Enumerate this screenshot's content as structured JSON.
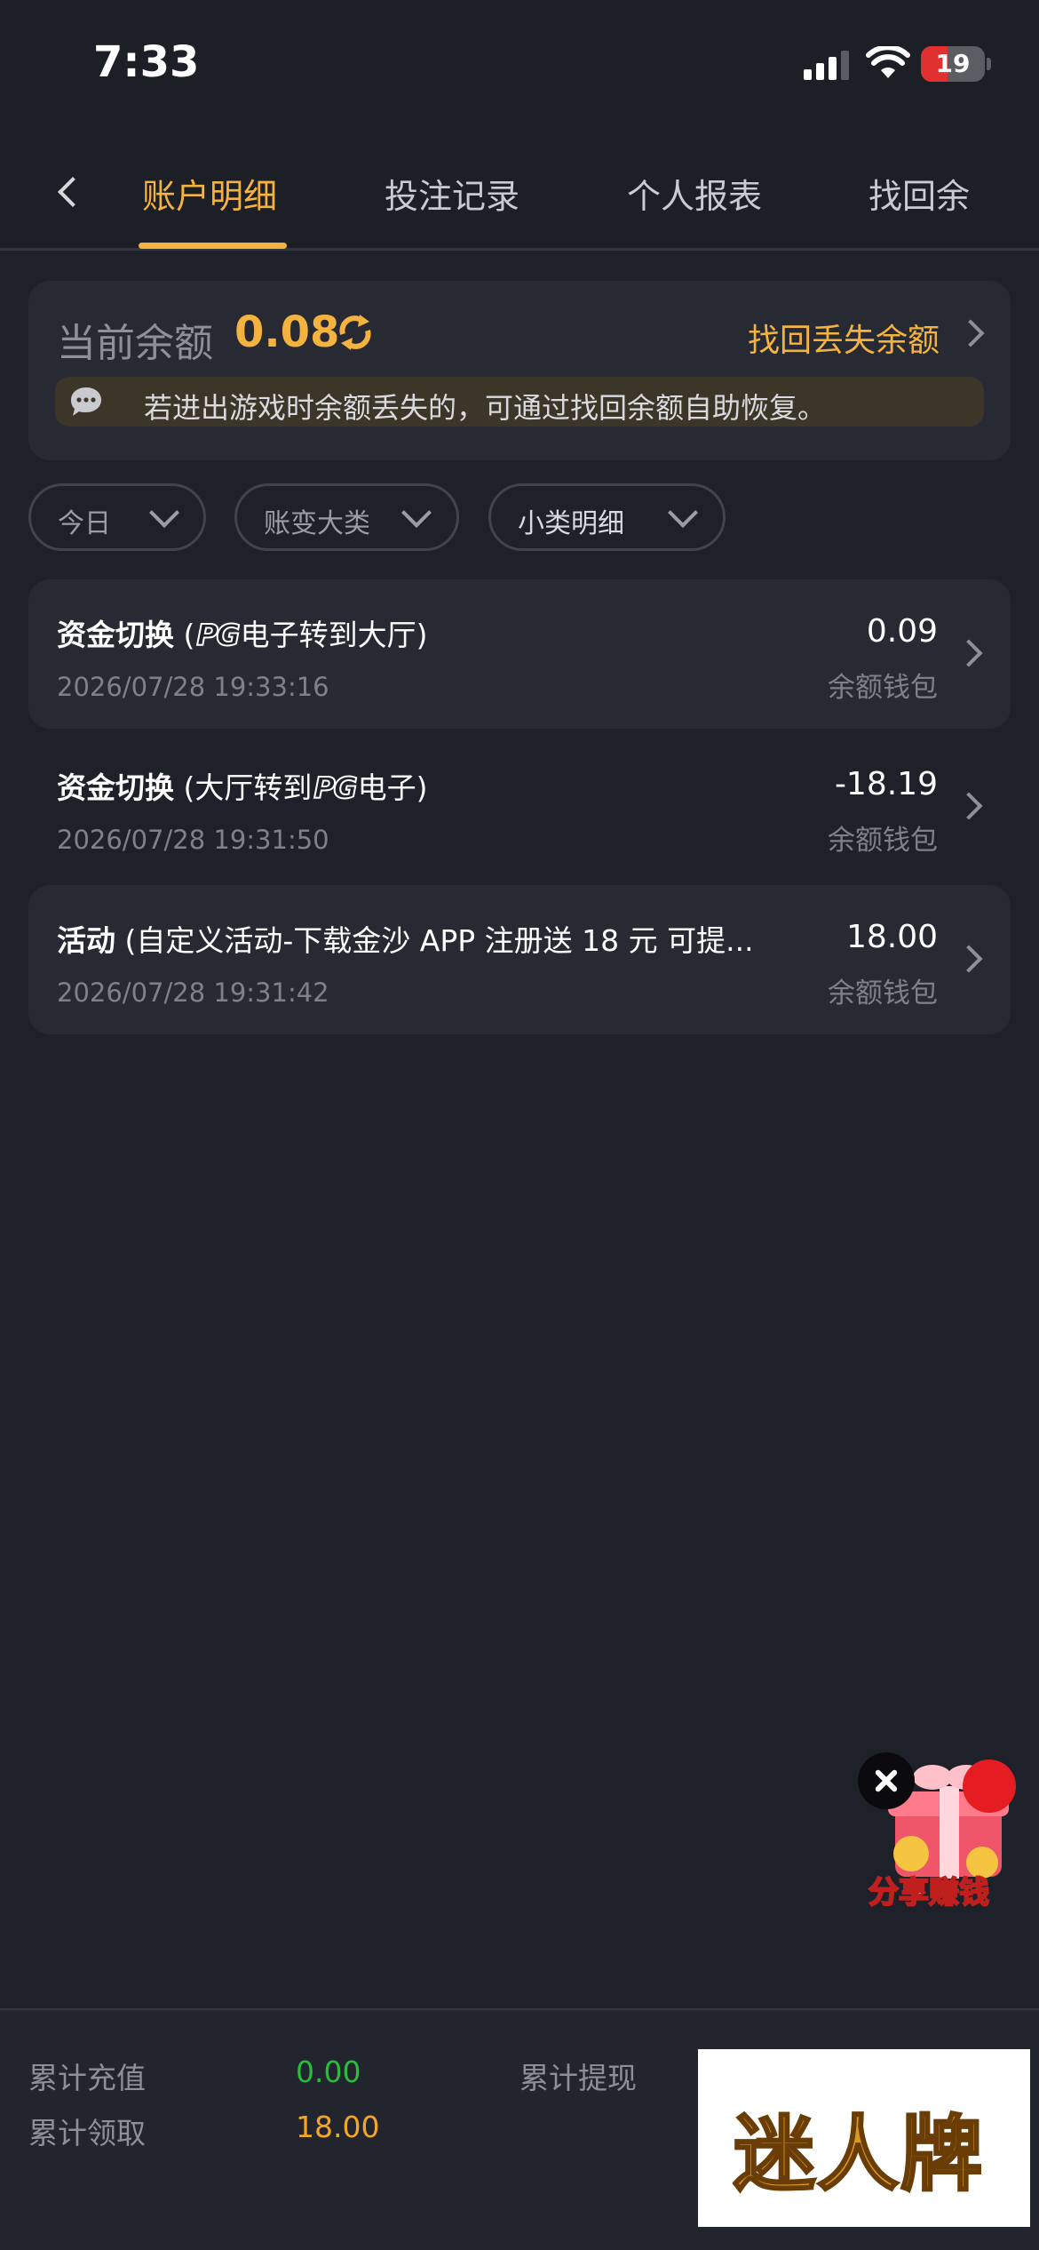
{
  "status_bar": {
    "time": "7:33",
    "battery": "19",
    "battery_level": 0.19
  },
  "nav": {
    "tabs": [
      {
        "label": "账户明细",
        "active": true
      },
      {
        "label": "投注记录",
        "active": false
      },
      {
        "label": "个人报表",
        "active": false
      },
      {
        "label": "找回余",
        "active": false
      }
    ]
  },
  "balance": {
    "label": "当前余额",
    "value": "0.08",
    "recover_link": "找回丢失余额",
    "notice": "若进出游戏时余额丢失的，可通过找回余额自助恢复。"
  },
  "filters": [
    {
      "label": "今日"
    },
    {
      "label": "账变大类"
    },
    {
      "label": "小类明细"
    }
  ],
  "records": [
    {
      "type": "资金切换",
      "detail_prefix": " (",
      "pg": "PG",
      "detail": "电子转到大厅)",
      "date": "2026/07/28 19:33:16",
      "amount": "0.09",
      "wallet": "余额钱包"
    },
    {
      "type": "资金切换",
      "detail_prefix": " (大厅转到",
      "pg": "PG",
      "detail": "电子)",
      "date": "2026/07/28 19:31:50",
      "amount": "-18.19",
      "wallet": "余额钱包"
    },
    {
      "type": "活动",
      "detail_prefix": " (自定义活动-下载金沙 APP 注册送 18 元 可提...",
      "pg": "",
      "detail": "",
      "date": "2026/07/28 19:31:42",
      "amount": "18.00",
      "wallet": "余额钱包"
    }
  ],
  "promo": {
    "label": "分享赚钱"
  },
  "footer": {
    "total_deposit_label": "累计充值",
    "total_deposit_value": "0.00",
    "total_withdraw_label": "累计提现",
    "total_claim_label": "累计领取",
    "total_claim_value": "18.00"
  },
  "watermark": {
    "text": "迷人牌"
  },
  "colors": {
    "accent": "#f4b23e",
    "green": "#2dbb3c",
    "orange": "#f4a623",
    "background": "#1f212a"
  }
}
